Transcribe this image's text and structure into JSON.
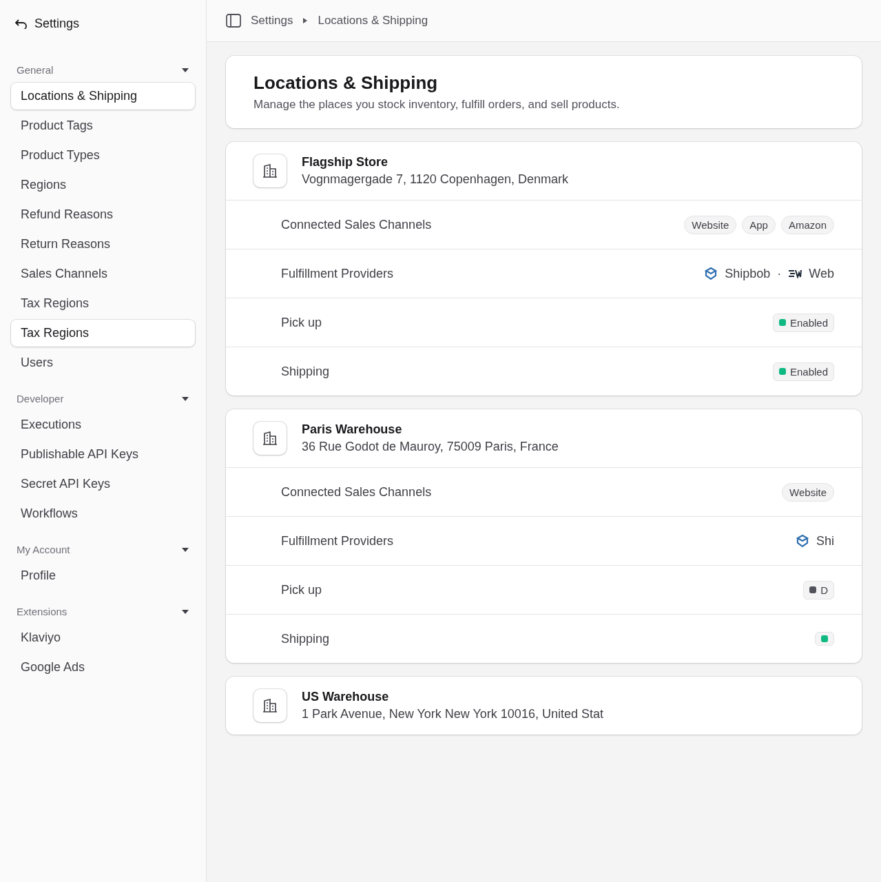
{
  "sidebar": {
    "back_label": "Settings",
    "groups": [
      {
        "title": "General",
        "items": [
          {
            "label": "Locations & Shipping",
            "selected": true
          },
          {
            "label": "Product Tags",
            "selected": false
          },
          {
            "label": "Product Types",
            "selected": false
          },
          {
            "label": "Regions",
            "selected": false
          },
          {
            "label": "Refund Reasons",
            "selected": false
          },
          {
            "label": "Return Reasons",
            "selected": false
          },
          {
            "label": "Sales Channels",
            "selected": false
          },
          {
            "label": "Tax Regions",
            "selected": false
          },
          {
            "label": "Tax Regions",
            "selected": true
          },
          {
            "label": "Users",
            "selected": false
          }
        ]
      },
      {
        "title": "Developer",
        "items": [
          {
            "label": "Executions",
            "selected": false
          },
          {
            "label": "Publishable API Keys",
            "selected": false
          },
          {
            "label": "Secret API Keys",
            "selected": false
          },
          {
            "label": "Workflows",
            "selected": false
          }
        ]
      },
      {
        "title": "My Account",
        "items": [
          {
            "label": "Profile",
            "selected": false
          }
        ]
      },
      {
        "title": "Extensions",
        "items": [
          {
            "label": "Klaviyo",
            "selected": false
          },
          {
            "label": "Google Ads",
            "selected": false
          }
        ]
      }
    ]
  },
  "breadcrumb": [
    "Settings",
    "Locations & Shipping"
  ],
  "header": {
    "title": "Locations & Shipping",
    "subtitle": "Manage the places you stock inventory, fulfill orders, and sell products."
  },
  "locations": [
    {
      "name": "Flagship Store",
      "address": "Vognmagergade 7, 1120 Copenhagen, Denmark",
      "rows": [
        {
          "kind": "channels",
          "label": "Connected Sales Channels",
          "tags": [
            "Website",
            "App",
            "Amazon"
          ]
        },
        {
          "kind": "providers",
          "label": "Fulfillment Providers",
          "providers": [
            "Shipbob",
            "Web"
          ],
          "separator": "·"
        },
        {
          "kind": "status",
          "label": "Pick up",
          "status": {
            "enabled": true,
            "text": "Enabled"
          }
        },
        {
          "kind": "status",
          "label": "Shipping",
          "status": {
            "enabled": true,
            "text": "Enabled"
          }
        }
      ]
    },
    {
      "name": "Paris Warehouse",
      "address": "36 Rue Godot de Mauroy, 75009 Paris, France",
      "rows": [
        {
          "kind": "channels",
          "label": "Connected Sales Channels",
          "tags": [
            "Website"
          ]
        },
        {
          "kind": "providers",
          "label": "Fulfillment Providers",
          "providers": [
            "Shi"
          ]
        },
        {
          "kind": "status",
          "label": "Pick up",
          "status": {
            "enabled": false,
            "text": "D"
          }
        },
        {
          "kind": "status",
          "label": "Shipping",
          "status": {
            "enabled": true
          }
        }
      ]
    },
    {
      "name": "US Warehouse",
      "address": "1 Park Avenue, New York New York 10016, United Stat"
    }
  ]
}
